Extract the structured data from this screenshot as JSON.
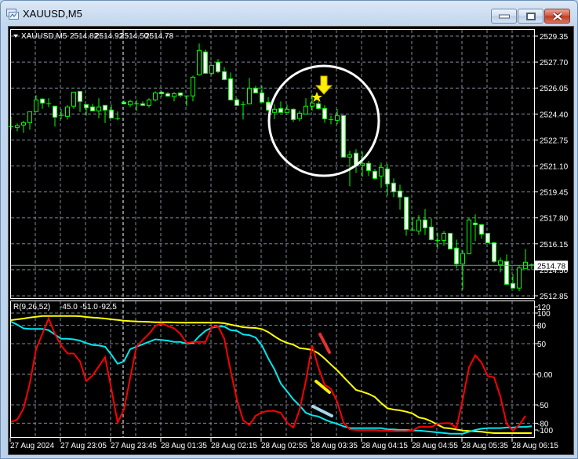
{
  "window": {
    "title": "XAUUSD,M5",
    "buttons": [
      "minimize",
      "maximize",
      "close"
    ]
  },
  "chart_header": {
    "symbol": "XAUUSD,M5",
    "open": "2514.82",
    "high": "2514.92",
    "low": "2514.50",
    "close": "2514.78"
  },
  "indicator_header": {
    "name": "R(9,26,52)",
    "v1": "-45.0",
    "v2": "-51.0",
    "v3": "-92.5"
  },
  "current_price_label": "2514.78",
  "colors": {
    "background": "#000000",
    "candle_outline": "#00ff00",
    "bear_body": "#ffffff",
    "bull_body": "#000000",
    "grid": "#7f8a99",
    "red_line": "#ff0000",
    "cyan_line": "#00e8f0",
    "yellow_line": "#ffff00",
    "annotation_red": "#e83030",
    "annotation_yellow": "#ffee00",
    "annotation_lightblue": "#a8d8e8",
    "marker_yellow": "#ffee00",
    "circle": "#ffffff"
  },
  "annotations": {
    "star_icon": "star-icon",
    "arrow_icon": "arrow-down-icon",
    "circle": "highlight-circle"
  },
  "chart_data": {
    "type": "candlestick",
    "price_axis_labels": [
      "2529.35",
      "2527.70",
      "2526.05",
      "2524.40",
      "2522.75",
      "2521.10",
      "2519.45",
      "2517.80",
      "2516.15",
      "2514.50",
      "2512.85"
    ],
    "price_range": [
      2512.85,
      2529.35
    ],
    "time_labels": [
      "27 Aug 2024",
      "27 Aug 23:05",
      "27 Aug 23:45",
      "28 Aug 01:35",
      "28 Aug 02:15",
      "28 Aug 02:55",
      "28 Aug 03:35",
      "28 Aug 04:15",
      "28 Aug 04:55",
      "28 Aug 05:35",
      "28 Aug 06:15"
    ],
    "candles_ohlc": [
      [
        2523.6,
        2524.23,
        2523.4,
        2523.6
      ],
      [
        2523.55,
        2523.8,
        2523.3,
        2523.67
      ],
      [
        2523.7,
        2523.97,
        2523.2,
        2523.85
      ],
      [
        2523.85,
        2524.55,
        2523.4,
        2524.55
      ],
      [
        2524.55,
        2525.59,
        2524.55,
        2525.3
      ],
      [
        2525.35,
        2525.4,
        2524.73,
        2525.1
      ],
      [
        2525.06,
        2525.4,
        2524.83,
        2525.0
      ],
      [
        2524.9,
        2524.9,
        2523.6,
        2524.2
      ],
      [
        2524.3,
        2524.7,
        2524.07,
        2524.25
      ],
      [
        2524.25,
        2524.95,
        2524.05,
        2524.85
      ],
      [
        2524.9,
        2525.79,
        2524.73,
        2525.79
      ],
      [
        2525.84,
        2525.84,
        2524.53,
        2525.2
      ],
      [
        2525.0,
        2525.0,
        2524.3,
        2524.8
      ],
      [
        2524.85,
        2525.05,
        2524.6,
        2524.6
      ],
      [
        2524.6,
        2525.4,
        2524.13,
        2524.85
      ],
      [
        2524.95,
        2524.95,
        2523.83,
        2524.65
      ],
      [
        2524.65,
        2525.0,
        2524.15,
        2524.15
      ],
      [
        2524.1,
        2524.56,
        2524.0,
        2524.1
      ],
      [
        2525.15,
        2525.26,
        2525.05,
        2525.05
      ],
      [
        2524.98,
        2525.3,
        2524.83,
        2525.2
      ],
      [
        2525.06,
        2525.3,
        2524.6,
        2525.06
      ],
      [
        2525.05,
        2525.2,
        2524.9,
        2524.95
      ],
      [
        2524.95,
        2525.4,
        2524.8,
        2525.3
      ],
      [
        2525.3,
        2525.84,
        2525.2,
        2525.74
      ],
      [
        2525.79,
        2525.84,
        2525.5,
        2525.69
      ],
      [
        2525.69,
        2525.79,
        2525.5,
        2525.54
      ],
      [
        2525.5,
        2525.79,
        2525.2,
        2525.69
      ],
      [
        2525.74,
        2525.74,
        2525.45,
        2525.59
      ],
      [
        2525.55,
        2525.55,
        2524.9,
        2525.55
      ],
      [
        2525.55,
        2526.84,
        2525.2,
        2526.74
      ],
      [
        2526.89,
        2528.88,
        2526.84,
        2528.44
      ],
      [
        2528.34,
        2528.49,
        2526.94,
        2526.99
      ],
      [
        2526.99,
        2527.49,
        2526.89,
        2527.49
      ],
      [
        2527.69,
        2527.89,
        2526.99,
        2527.09
      ],
      [
        2527.09,
        2527.39,
        2526.54,
        2526.59
      ],
      [
        2526.64,
        2527.04,
        2525.25,
        2525.3
      ],
      [
        2525.3,
        2525.4,
        2524.9,
        2524.95
      ],
      [
        2525.0,
        2525.2,
        2524.05,
        2525.0
      ],
      [
        2525.05,
        2526.69,
        2525.0,
        2526.04
      ],
      [
        2526.04,
        2526.19,
        2525.74,
        2525.74
      ],
      [
        2525.74,
        2526.19,
        2525.15,
        2525.15
      ],
      [
        2525.15,
        2525.48,
        2524.6,
        2524.65
      ],
      [
        2524.5,
        2525.01,
        2524.07,
        2524.7
      ],
      [
        2524.75,
        2525.2,
        2524.5,
        2524.5
      ],
      [
        2524.5,
        2525.0,
        2524.5,
        2524.7
      ],
      [
        2524.7,
        2524.75,
        2523.9,
        2524.05
      ],
      [
        2524.1,
        2524.6,
        2523.95,
        2524.45
      ],
      [
        2524.4,
        2525.4,
        2524.4,
        2524.9
      ],
      [
        2524.9,
        2525.65,
        2524.6,
        2525.1
      ],
      [
        2525.05,
        2525.2,
        2524.7,
        2524.75
      ],
      [
        2524.75,
        2524.95,
        2523.85,
        2524.1
      ],
      [
        2524.05,
        2524.3,
        2523.75,
        2524.0
      ],
      [
        2524.0,
        2524.7,
        2523.75,
        2524.3
      ],
      [
        2524.3,
        2524.3,
        2521.66,
        2521.66
      ],
      [
        2521.66,
        2522.06,
        2519.81,
        2521.81
      ],
      [
        2521.91,
        2522.16,
        2520.66,
        2521.16
      ],
      [
        2521.16,
        2522.01,
        2520.41,
        2521.26
      ],
      [
        2521.26,
        2521.41,
        2520.46,
        2520.81
      ],
      [
        2520.76,
        2520.91,
        2520.21,
        2520.31
      ],
      [
        2520.46,
        2521.31,
        2519.71,
        2521.01
      ],
      [
        2520.91,
        2521.21,
        2519.22,
        2519.96
      ],
      [
        2520.01,
        2520.31,
        2519.12,
        2519.46
      ],
      [
        2519.51,
        2519.91,
        2518.32,
        2519.12
      ],
      [
        2519.12,
        2519.12,
        2516.67,
        2517.07
      ],
      [
        2517.03,
        2517.82,
        2517.0,
        2517.03
      ],
      [
        2516.97,
        2517.97,
        2516.72,
        2517.67
      ],
      [
        2517.67,
        2518.37,
        2516.72,
        2517.17
      ],
      [
        2517.22,
        2517.77,
        2516.37,
        2516.42
      ],
      [
        2516.37,
        2516.87,
        2515.83,
        2516.37
      ],
      [
        2516.37,
        2516.97,
        2516.03,
        2516.82
      ],
      [
        2516.82,
        2516.82,
        2515.83,
        2515.83
      ],
      [
        2515.88,
        2516.42,
        2514.58,
        2514.88
      ],
      [
        2514.88,
        2515.73,
        2513.24,
        2515.53
      ],
      [
        2515.53,
        2517.77,
        2515.48,
        2517.67
      ],
      [
        2517.47,
        2518.02,
        2516.32,
        2517.37
      ],
      [
        2517.37,
        2517.42,
        2516.47,
        2516.77
      ],
      [
        2516.82,
        2516.82,
        2516.22,
        2516.22
      ],
      [
        2516.22,
        2516.27,
        2514.93,
        2515.03
      ],
      [
        2514.83,
        2515.28,
        2514.33,
        2515.08
      ],
      [
        2515.03,
        2515.48,
        2513.58,
        2513.58
      ],
      [
        2513.63,
        2514.23,
        2513.34,
        2513.34
      ],
      [
        2513.34,
        2514.78,
        2513.14,
        2514.63
      ],
      [
        2514.58,
        2515.83,
        2514.53,
        2514.98
      ],
      [
        2514.82,
        2514.92,
        2514.5,
        2514.78
      ]
    ],
    "indicator": {
      "axis_labels": [
        "120",
        "100",
        "80",
        "50",
        "0.00",
        "-50",
        "-80",
        "-100"
      ],
      "axis_values": [
        120,
        100,
        80,
        50,
        0,
        -50,
        -80,
        -100
      ],
      "grid_levels": [
        100,
        80,
        50,
        0,
        -50,
        -80
      ],
      "range": [
        -100,
        120
      ],
      "series": [
        {
          "name": "red",
          "values": [
            -78,
            -74,
            -56,
            -15,
            41,
            66,
            91,
            66,
            47,
            34,
            34,
            21,
            -11,
            -2,
            13,
            28,
            -24,
            -79,
            -58,
            -6,
            45,
            56,
            66,
            79,
            83,
            79,
            75,
            66,
            51,
            53,
            53,
            53,
            77,
            79,
            58,
            6,
            -41,
            -75,
            -83,
            -68,
            -62,
            -60,
            -60,
            -63,
            -79,
            -87,
            -58,
            -11,
            47,
            11,
            -17,
            -24,
            -45,
            -79,
            -90,
            -91,
            -91,
            -91,
            -91,
            -92,
            -92,
            -93,
            -93,
            -93,
            -92,
            -86,
            -86,
            -86,
            -81,
            -80,
            -80,
            -88,
            -41,
            11,
            31,
            19,
            -3,
            -5,
            -36,
            -81,
            -92,
            -83,
            -68
          ]
        },
        {
          "name": "cyan",
          "values": [
            86,
            81,
            75,
            74,
            74,
            74,
            72,
            65,
            58,
            58,
            57,
            55,
            51,
            48,
            47,
            45,
            32,
            17,
            21,
            41,
            45,
            49,
            53,
            57,
            56,
            55,
            53,
            53,
            50,
            51,
            62,
            71,
            76,
            78,
            78,
            72,
            71,
            65,
            64,
            60,
            47,
            26,
            8,
            -15,
            -28,
            -41,
            -51,
            -63,
            -67,
            -69,
            -74,
            -78,
            -81,
            -85,
            -88,
            -88,
            -88,
            -88,
            -88,
            -88,
            -90,
            -90,
            -91,
            -91,
            -92,
            -92,
            -93,
            -94,
            -95,
            -96,
            -97,
            -97,
            -97,
            -94,
            -91,
            -89,
            -88,
            -88,
            -88,
            -87,
            -87,
            -86,
            -86,
            -85
          ]
        },
        {
          "name": "yellow",
          "values": [
            88.5,
            89.7,
            91,
            92.7,
            94,
            95.3,
            95.3,
            95.3,
            95.3,
            95.3,
            95.3,
            94.9,
            93.6,
            92.7,
            91.9,
            91,
            89.7,
            88.9,
            87.6,
            86.8,
            86.3,
            85.9,
            85.5,
            85,
            85,
            85,
            84.6,
            84.2,
            84.2,
            84.2,
            84.2,
            84.2,
            84.2,
            84.2,
            83.3,
            81.2,
            79,
            76.9,
            76.1,
            75.6,
            73.9,
            69,
            62,
            55.6,
            51.3,
            48.3,
            42.7,
            41.5,
            39.7,
            34.2,
            25.6,
            15.8,
            6.4,
            -4.3,
            -15,
            -25.6,
            -28.6,
            -32,
            -37.2,
            -47,
            -55.6,
            -57.7,
            -59,
            -61.1,
            -64.1,
            -70.5,
            -72.7,
            -76.9,
            -82.5,
            -87.6,
            -88.5,
            -90.2,
            -91.9,
            -92.7,
            -93.2,
            -94,
            -95.3,
            -96.2,
            -96.2,
            -96.2,
            -96.2,
            -96.2,
            -96.2,
            -96.2
          ]
        }
      ]
    }
  }
}
